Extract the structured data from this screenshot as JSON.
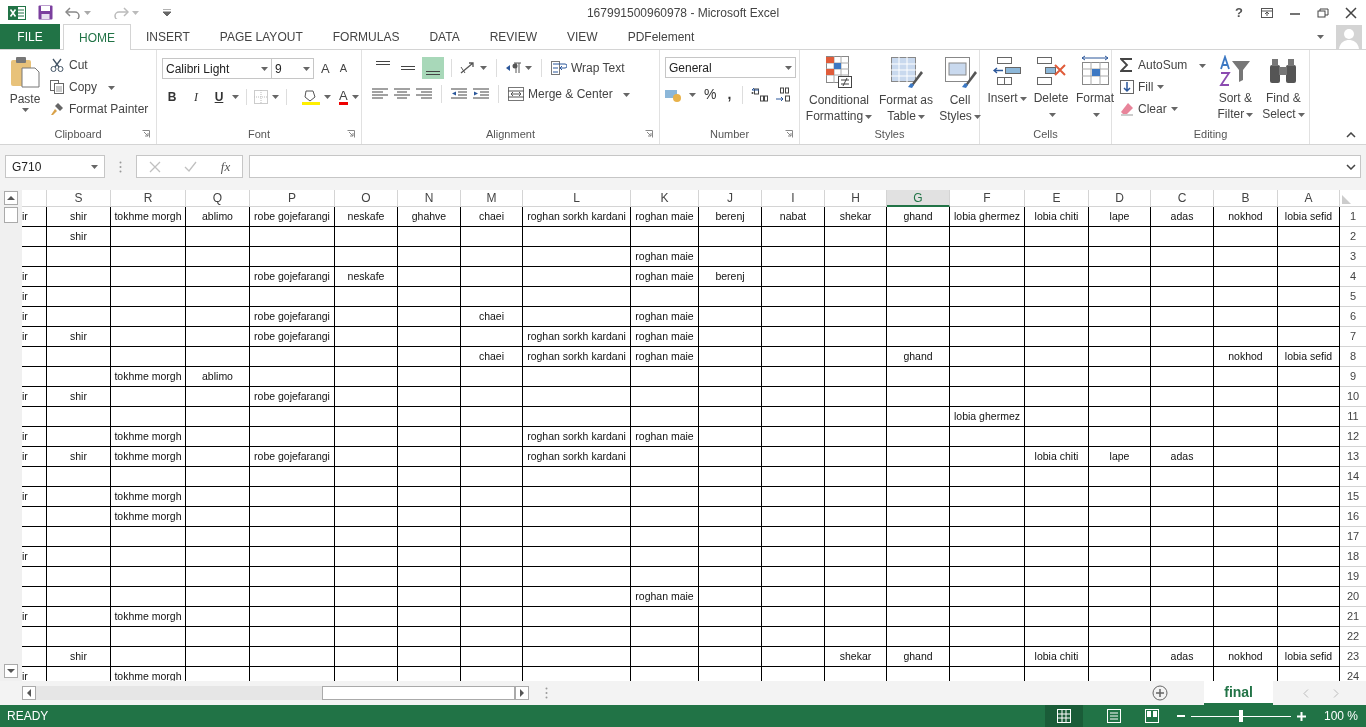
{
  "title_bar": {
    "title": "167991500960978 - Microsoft Excel",
    "help": "?"
  },
  "tabs": [
    {
      "label": "FILE",
      "kind": "file",
      "selected": false
    },
    {
      "label": "HOME",
      "kind": "tab",
      "selected": true
    },
    {
      "label": "INSERT",
      "kind": "tab",
      "selected": false
    },
    {
      "label": "PAGE LAYOUT",
      "kind": "tab",
      "selected": false
    },
    {
      "label": "FORMULAS",
      "kind": "tab",
      "selected": false
    },
    {
      "label": "DATA",
      "kind": "tab",
      "selected": false
    },
    {
      "label": "REVIEW",
      "kind": "tab",
      "selected": false
    },
    {
      "label": "VIEW",
      "kind": "tab",
      "selected": false
    },
    {
      "label": "PDFelement",
      "kind": "tab",
      "selected": false
    }
  ],
  "clipboard": {
    "paste": "Paste",
    "cut": "Cut",
    "copy": "Copy",
    "format_painter": "Format Painter",
    "label": "Clipboard"
  },
  "font": {
    "name": "Calibri Light",
    "size": "9",
    "grow": "A",
    "shrink": "A",
    "bold": "B",
    "italic": "I",
    "underline": "U",
    "font_color": "A",
    "label": "Font"
  },
  "alignment": {
    "vertical_align": [
      {
        "selected": false
      },
      {
        "selected": false
      },
      {
        "selected": true
      }
    ],
    "wrap_text": "Wrap Text",
    "merge": "Merge & Center",
    "label": "Alignment"
  },
  "number": {
    "format": "General",
    "percent": "%",
    "comma": ",",
    "label": "Number"
  },
  "styles": {
    "buttons": [
      "Conditional Formatting",
      "Format as Table",
      "Cell Styles"
    ],
    "label": "Styles"
  },
  "cells": {
    "buttons": [
      "Insert",
      "Delete",
      "Format"
    ],
    "label": "Cells"
  },
  "editing": {
    "autosum": "AutoSum",
    "fill": "Fill",
    "clear": "Clear",
    "buttons": [
      "Sort & Filter",
      "Find & Select"
    ],
    "label": "Editing"
  },
  "name_box": "G710",
  "formula_label": "fx",
  "columns": [
    {
      "label": "S",
      "selected": false
    },
    {
      "label": "R",
      "selected": false
    },
    {
      "label": "Q",
      "selected": false
    },
    {
      "label": "P",
      "selected": false
    },
    {
      "label": "O",
      "selected": false
    },
    {
      "label": "N",
      "selected": false
    },
    {
      "label": "M",
      "selected": false
    },
    {
      "label": "L",
      "selected": false
    },
    {
      "label": "K",
      "selected": false
    },
    {
      "label": "J",
      "selected": false
    },
    {
      "label": "I",
      "selected": false
    },
    {
      "label": "H",
      "selected": false
    },
    {
      "label": "G",
      "selected": true
    },
    {
      "label": "F",
      "selected": false
    },
    {
      "label": "E",
      "selected": false
    },
    {
      "label": "D",
      "selected": false
    },
    {
      "label": "C",
      "selected": false
    },
    {
      "label": "B",
      "selected": false
    },
    {
      "label": "A",
      "selected": false
    }
  ],
  "rows": [
    {
      "number": "1",
      "cells": [
        "ir",
        "shir",
        "tokhme morgh",
        "ablimo",
        "robe gojefarangi",
        "neskafe",
        "ghahve",
        "chaei",
        "roghan sorkh kardani",
        "roghan maie",
        "berenj",
        "nabat",
        "shekar",
        "ghand",
        "lobia ghermez",
        "lobia chiti",
        "lape",
        "adas",
        "nokhod",
        "lobia sefid"
      ]
    },
    {
      "number": "2",
      "cells": [
        null,
        "shir",
        null,
        null,
        null,
        null,
        null,
        null,
        null,
        null,
        null,
        null,
        null,
        null,
        null,
        null,
        null,
        null,
        null,
        null
      ]
    },
    {
      "number": "3",
      "cells": [
        null,
        null,
        null,
        null,
        null,
        null,
        null,
        null,
        null,
        "roghan maie",
        null,
        null,
        null,
        null,
        null,
        null,
        null,
        null,
        null,
        null
      ]
    },
    {
      "number": "4",
      "cells": [
        "ir",
        null,
        null,
        null,
        "robe gojefarangi",
        "neskafe",
        null,
        null,
        null,
        "roghan maie",
        "berenj",
        null,
        null,
        null,
        null,
        null,
        null,
        null,
        null,
        null
      ]
    },
    {
      "number": "5",
      "cells": [
        "ir",
        null,
        null,
        null,
        null,
        null,
        null,
        null,
        null,
        null,
        null,
        null,
        null,
        null,
        null,
        null,
        null,
        null,
        null,
        null
      ]
    },
    {
      "number": "6",
      "cells": [
        "ir",
        null,
        null,
        null,
        "robe gojefarangi",
        null,
        null,
        "chaei",
        null,
        "roghan maie",
        null,
        null,
        null,
        null,
        null,
        null,
        null,
        null,
        null,
        null
      ]
    },
    {
      "number": "7",
      "cells": [
        "ir",
        "shir",
        null,
        null,
        "robe gojefarangi",
        null,
        null,
        null,
        "roghan sorkh kardani",
        "roghan maie",
        null,
        null,
        null,
        null,
        null,
        null,
        null,
        null,
        null,
        null
      ]
    },
    {
      "number": "8",
      "cells": [
        null,
        null,
        null,
        null,
        null,
        null,
        null,
        "chaei",
        "roghan sorkh kardani",
        "roghan maie",
        null,
        null,
        null,
        "ghand",
        null,
        null,
        null,
        null,
        "nokhod",
        "lobia sefid"
      ]
    },
    {
      "number": "9",
      "cells": [
        null,
        null,
        "tokhme morgh",
        "ablimo",
        null,
        null,
        null,
        null,
        null,
        null,
        null,
        null,
        null,
        null,
        null,
        null,
        null,
        null,
        null,
        null
      ]
    },
    {
      "number": "10",
      "cells": [
        "ir",
        "shir",
        null,
        null,
        "robe gojefarangi",
        null,
        null,
        null,
        null,
        null,
        null,
        null,
        null,
        null,
        null,
        null,
        null,
        null,
        null,
        null
      ]
    },
    {
      "number": "11",
      "cells": [
        null,
        null,
        null,
        null,
        null,
        null,
        null,
        null,
        null,
        null,
        null,
        null,
        null,
        null,
        "lobia ghermez",
        null,
        null,
        null,
        null,
        null
      ]
    },
    {
      "number": "12",
      "cells": [
        "ir",
        null,
        "tokhme morgh",
        null,
        null,
        null,
        null,
        null,
        "roghan sorkh kardani",
        "roghan maie",
        null,
        null,
        null,
        null,
        null,
        null,
        null,
        null,
        null,
        null
      ]
    },
    {
      "number": "13",
      "cells": [
        "ir",
        "shir",
        "tokhme morgh",
        null,
        "robe gojefarangi",
        null,
        null,
        null,
        "roghan sorkh kardani",
        null,
        null,
        null,
        null,
        null,
        null,
        "lobia chiti",
        "lape",
        "adas",
        null,
        null
      ]
    },
    {
      "number": "14",
      "cells": [
        null,
        null,
        null,
        null,
        null,
        null,
        null,
        null,
        null,
        null,
        null,
        null,
        null,
        null,
        null,
        null,
        null,
        null,
        null,
        null
      ]
    },
    {
      "number": "15",
      "cells": [
        "ir",
        null,
        "tokhme morgh",
        null,
        null,
        null,
        null,
        null,
        null,
        null,
        null,
        null,
        null,
        null,
        null,
        null,
        null,
        null,
        null,
        null
      ]
    },
    {
      "number": "16",
      "cells": [
        null,
        null,
        "tokhme morgh",
        null,
        null,
        null,
        null,
        null,
        null,
        null,
        null,
        null,
        null,
        null,
        null,
        null,
        null,
        null,
        null,
        null
      ]
    },
    {
      "number": "17",
      "cells": [
        null,
        null,
        null,
        null,
        null,
        null,
        null,
        null,
        null,
        null,
        null,
        null,
        null,
        null,
        null,
        null,
        null,
        null,
        null,
        null
      ]
    },
    {
      "number": "18",
      "cells": [
        "ir",
        null,
        null,
        null,
        null,
        null,
        null,
        null,
        null,
        null,
        null,
        null,
        null,
        null,
        null,
        null,
        null,
        null,
        null,
        null
      ]
    },
    {
      "number": "19",
      "cells": [
        null,
        null,
        null,
        null,
        null,
        null,
        null,
        null,
        null,
        null,
        null,
        null,
        null,
        null,
        null,
        null,
        null,
        null,
        null,
        null
      ]
    },
    {
      "number": "20",
      "cells": [
        null,
        null,
        null,
        null,
        null,
        null,
        null,
        null,
        null,
        "roghan maie",
        null,
        null,
        null,
        null,
        null,
        null,
        null,
        null,
        null,
        null
      ]
    },
    {
      "number": "21",
      "cells": [
        "ir",
        null,
        "tokhme morgh",
        null,
        null,
        null,
        null,
        null,
        null,
        null,
        null,
        null,
        null,
        null,
        null,
        null,
        null,
        null,
        null,
        null
      ]
    },
    {
      "number": "22",
      "cells": [
        null,
        null,
        null,
        null,
        null,
        null,
        null,
        null,
        null,
        null,
        null,
        null,
        null,
        null,
        null,
        null,
        null,
        null,
        null,
        null
      ]
    },
    {
      "number": "23",
      "cells": [
        null,
        "shir",
        null,
        null,
        null,
        null,
        null,
        null,
        null,
        null,
        null,
        null,
        "shekar",
        "ghand",
        null,
        "lobia chiti",
        null,
        "adas",
        "nokhod",
        "lobia sefid"
      ]
    },
    {
      "number": "24",
      "cells": [
        "ir",
        null,
        "tokhme morgh",
        null,
        null,
        null,
        null,
        null,
        null,
        null,
        null,
        null,
        null,
        null,
        null,
        null,
        null,
        null,
        null,
        null
      ]
    }
  ],
  "sheet_tabs": [
    {
      "label": "final",
      "selected": true
    }
  ],
  "status": "READY",
  "zoom": {
    "reading": "100 %",
    "level": 0.5
  }
}
